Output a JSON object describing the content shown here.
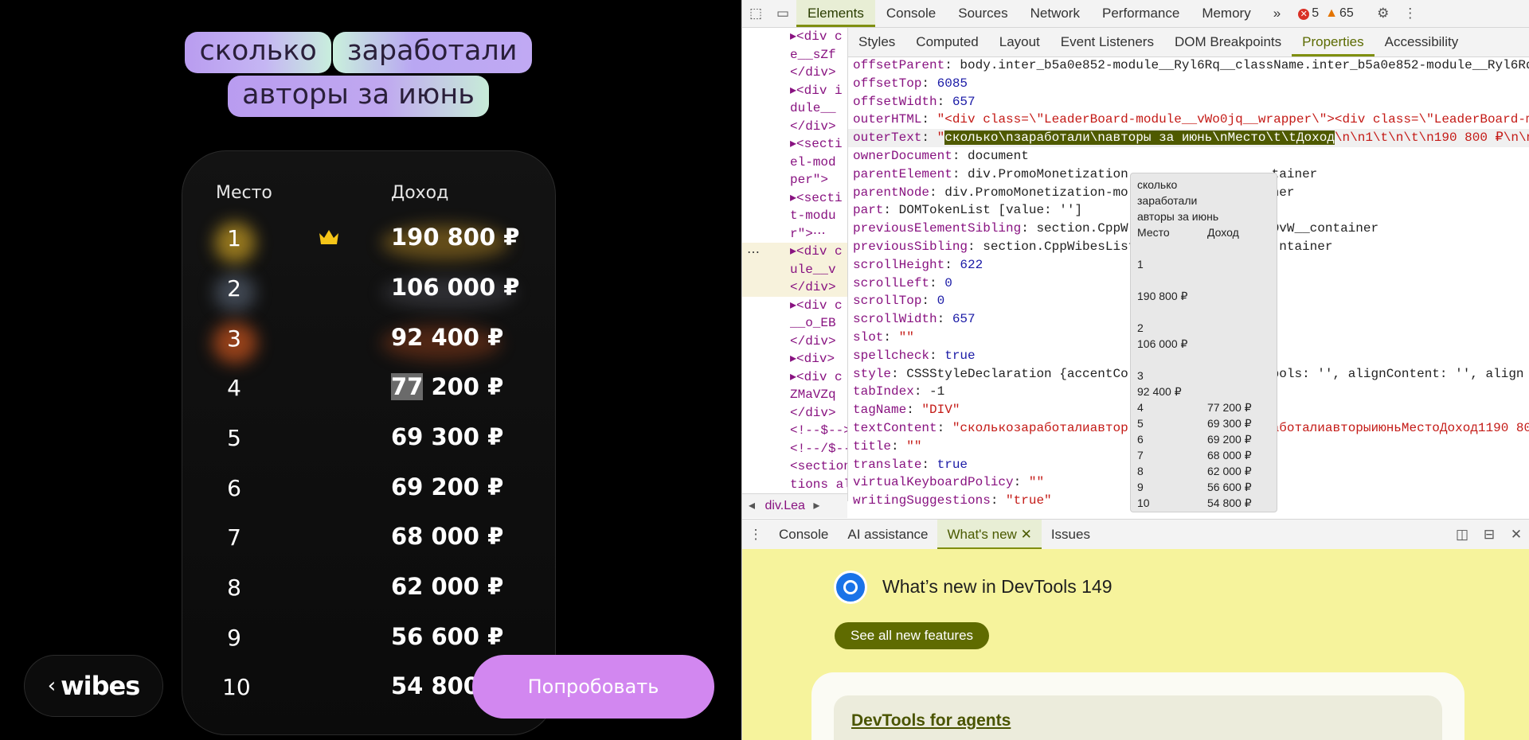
{
  "page": {
    "heading_words": [
      "сколько",
      "заработали",
      "авторы за июнь"
    ],
    "columns": {
      "place": "Место",
      "income": "Доход"
    },
    "rows": [
      {
        "place": "1",
        "amount": "190 800 ₽"
      },
      {
        "place": "2",
        "amount": "106 000 ₽"
      },
      {
        "place": "3",
        "amount": "92 400 ₽"
      },
      {
        "place": "4",
        "amount_hl": "77",
        "amount_rest": " 200 ₽"
      },
      {
        "place": "5",
        "amount": "69 300 ₽"
      },
      {
        "place": "6",
        "amount": "69 200 ₽"
      },
      {
        "place": "7",
        "amount": "68 000 ₽"
      },
      {
        "place": "8",
        "amount": "62 000 ₽"
      },
      {
        "place": "9",
        "amount": "56 600 ₽"
      },
      {
        "place": "10",
        "amount": "54 800"
      }
    ],
    "back_chevron": "‹",
    "logo": "wibes",
    "try_button": "Попробовать"
  },
  "devtools": {
    "tabs": [
      "Elements",
      "Console",
      "Sources",
      "Network",
      "Performance",
      "Memory"
    ],
    "more": "»",
    "errors": "5",
    "warnings": "65",
    "subtabs": [
      "Styles",
      "Computed",
      "Layout",
      "Event Listeners",
      "DOM Breakpoints",
      "Properties",
      "Accessibility"
    ],
    "dom_lines": [
      "▸<div c",
      "e__sZf",
      "</div>",
      "▸<div i",
      "dule__",
      "</div>",
      "▸<secti",
      "el-mod",
      "per\">",
      "▸<secti",
      "t-modu",
      "r\">⋯",
      "▸<div c",
      "ule__v",
      "</div>",
      "▸<div c",
      "__o_EB",
      "</div>",
      "▸<div>",
      "▸<div c",
      "ZMaVZq",
      "</div>",
      "<!--$-->",
      "<!--/$--",
      "<section",
      "tions al"
    ],
    "breadcrumb": "div.Lea",
    "properties": [
      {
        "k": "offsetParent",
        "v": "body.inter_b5a0e852-module__Ryl6Rq__className.inter_b5a0e852-module__Ryl6Rq"
      },
      {
        "k": "offsetTop",
        "v": "6085"
      },
      {
        "k": "offsetWidth",
        "v": "657"
      },
      {
        "k": "outerHTML",
        "v": "\"<div class=\\\"LeaderBoard-module__vWo0jq__wrapper\\\"><div class=\\\"LeaderBoard-mo"
      },
      {
        "k": "outerText",
        "v_hl": "сколько\\nзаработали\\nавторы за июнь\\nМесто\\t\\tДоход",
        "v": "\\n\\n1\\t\\n\\t\\n190 800 ₽\\n\\n2"
      },
      {
        "k": "ownerDocument",
        "v": "document"
      },
      {
        "k": "parentElement",
        "v": "div.PromoMonetization",
        "v2": "tainer"
      },
      {
        "k": "parentNode",
        "v": "div.PromoMonetization-mo",
        "v2": "ner"
      },
      {
        "k": "part",
        "v": "DOMTokenList [value: '']"
      },
      {
        "k": "previousElementSibling",
        "v": "section.CppW",
        "v2": "OvW__container"
      },
      {
        "k": "previousSibling",
        "v": "section.CppWibesList",
        "v2": "ntainer"
      },
      {
        "k": "scrollHeight",
        "v": "622"
      },
      {
        "k": "scrollLeft",
        "v": "0"
      },
      {
        "k": "scrollTop",
        "v": "0"
      },
      {
        "k": "scrollWidth",
        "v": "657"
      },
      {
        "k": "slot",
        "v": "\"\""
      },
      {
        "k": "spellcheck",
        "v": "true"
      },
      {
        "k": "style",
        "v": "CSSStyleDeclaration {accentCo",
        "v2": "bols: '', alignContent: '', align"
      },
      {
        "k": "tabIndex",
        "v": "-1"
      },
      {
        "k": "tagName",
        "v": "\"DIV\""
      },
      {
        "k": "textContent",
        "v": "\"сколькозаработалиавтор",
        "v2": "аботалиавторыиюньМестоДоход1190 80"
      },
      {
        "k": "title",
        "v": "\"\""
      },
      {
        "k": "translate",
        "v": "true"
      },
      {
        "k": "virtualKeyboardPolicy",
        "v": "\"\""
      },
      {
        "k": "writingSuggestions",
        "v": "\"true\""
      }
    ],
    "tooltip": [
      [
        "сколько",
        ""
      ],
      [
        "заработали",
        ""
      ],
      [
        "авторы за июнь",
        ""
      ],
      [
        "Место",
        "Доход"
      ],
      [
        "",
        ""
      ],
      [
        "1",
        ""
      ],
      [
        "",
        ""
      ],
      [
        "190 800 ₽",
        ""
      ],
      [
        "",
        ""
      ],
      [
        "2",
        ""
      ],
      [
        "106 000 ₽",
        ""
      ],
      [
        "",
        ""
      ],
      [
        "3",
        ""
      ],
      [
        "92 400 ₽",
        ""
      ],
      [
        "4",
        "77 200 ₽"
      ],
      [
        "5",
        "69 300 ₽"
      ],
      [
        "6",
        "69 200 ₽"
      ],
      [
        "7",
        "68 000 ₽"
      ],
      [
        "8",
        "62 000 ₽"
      ],
      [
        "9",
        "56 600 ₽"
      ],
      [
        "10",
        "54 800 ₽"
      ]
    ],
    "drawer_tabs": [
      "Console",
      "AI assistance",
      "What's new",
      "Issues"
    ],
    "whats_new_title": "What’s new in DevTools 149",
    "whats_new_button": "See all new features",
    "card_link": "DevTools for agents"
  }
}
